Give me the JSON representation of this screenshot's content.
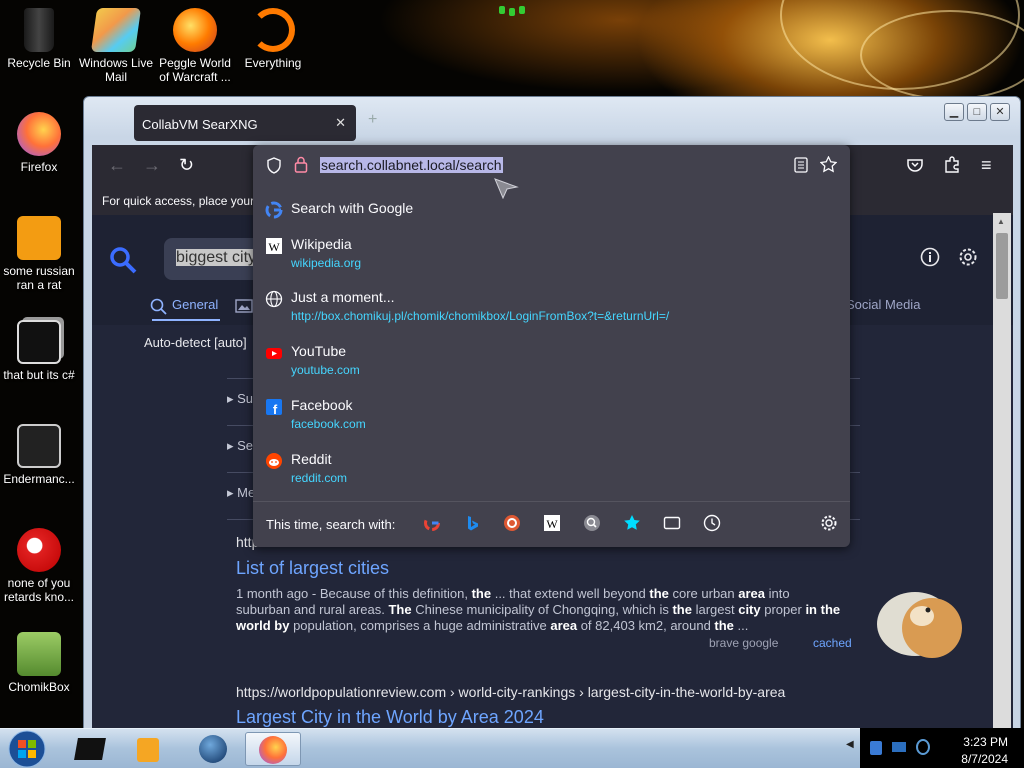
{
  "desktop": {
    "icons": [
      {
        "label": "Recycle Bin"
      },
      {
        "label": "Windows Live Mail"
      },
      {
        "label": "Peggle World of Warcraft ..."
      },
      {
        "label": "Everything"
      },
      {
        "label": "Firefox"
      },
      {
        "label": "some russian ran a rat"
      },
      {
        "label": "that but its c#"
      },
      {
        "label": "Endermanc..."
      },
      {
        "label": "none of you retards kno..."
      },
      {
        "label": "ChomikBox"
      }
    ]
  },
  "window": {
    "tab_title": "CollabVM SearXNG",
    "tab_close": "✕",
    "new_tab": "+"
  },
  "toolbar": {
    "back": "←",
    "forward": "→",
    "reload": "↻",
    "menu": "≡"
  },
  "bookmarks_bar": {
    "text": "For quick access, place your"
  },
  "urlbar": {
    "value": "search.collabnet.local/search",
    "suggestions": [
      {
        "title": "Search with Google",
        "url": ""
      },
      {
        "title": "Wikipedia",
        "url": "wikipedia.org"
      },
      {
        "title": "Just a moment...",
        "url": "http://box.chomikuj.pl/chomik/chomikbox/LoginFromBox?t=&returnUrl=/"
      },
      {
        "title": "YouTube",
        "url": "youtube.com"
      },
      {
        "title": "Facebook",
        "url": "facebook.com"
      },
      {
        "title": "Reddit",
        "url": "reddit.com"
      }
    ],
    "search_with_label": "This time, search with:",
    "engines": [
      "google-icon",
      "bing-icon",
      "duckduckgo-icon",
      "wikipedia-icon",
      "search-engine-icon",
      "bookmarks-star-icon",
      "tabs-icon",
      "history-icon"
    ]
  },
  "page": {
    "query": "biggest city in",
    "categories": [
      {
        "label": "General",
        "active": true
      },
      {
        "label": "Social Media",
        "active": false
      }
    ],
    "autodetect": "Auto-detect [auto]",
    "filters": [
      "Su",
      "Se",
      "Me"
    ],
    "results": [
      {
        "url_fragment": "http",
        "title": "List of largest cities",
        "snippet_line1": "1 month ago - Because of this definition, the ... that extend well beyond the core urban area into",
        "snippet_line2": "suburban and rural areas. The Chinese municipality of Chongqing, which is the largest city proper in the",
        "snippet_line3": "world by population, comprises a huge administrative area of 82,403 km2, around the ...",
        "engines": "brave  google",
        "cached": "cached"
      },
      {
        "url": "https://worldpopulationreview.com  › world-city-rankings › largest-city-in-the-world-by-area",
        "title": "Largest City in the World by Area 2024"
      }
    ]
  },
  "taskbar": {
    "time": "3:23 PM",
    "date": "8/7/2024"
  },
  "colors": {
    "firefox_panel": "#42414d",
    "link_cyan": "#45d6ff",
    "searx_bg": "#222639",
    "result_title": "#6ea5ff"
  }
}
